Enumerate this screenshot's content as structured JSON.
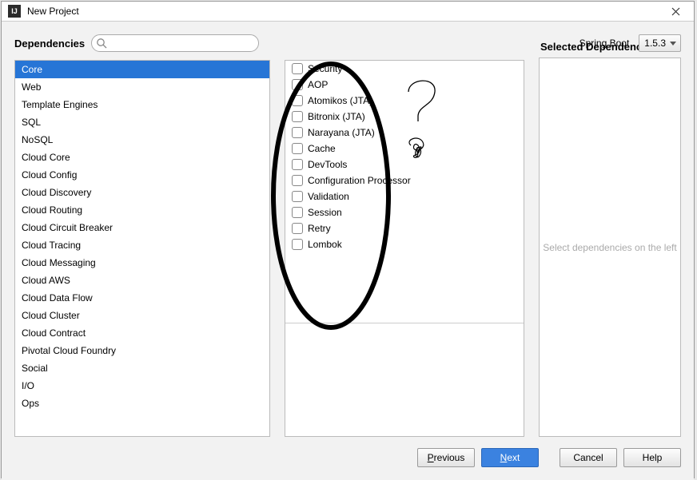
{
  "window": {
    "title": "New Project"
  },
  "header": {
    "dependencies_label": "Dependencies",
    "search_placeholder": "",
    "spring_boot_label": "Spring Boot",
    "spring_boot_version": "1.5.3"
  },
  "categories": [
    "Core",
    "Web",
    "Template Engines",
    "SQL",
    "NoSQL",
    "Cloud Core",
    "Cloud Config",
    "Cloud Discovery",
    "Cloud Routing",
    "Cloud Circuit Breaker",
    "Cloud Tracing",
    "Cloud Messaging",
    "Cloud AWS",
    "Cloud Data Flow",
    "Cloud Cluster",
    "Cloud Contract",
    "Pivotal Cloud Foundry",
    "Social",
    "I/O",
    "Ops"
  ],
  "selected_category_index": 0,
  "dependencies": [
    "Security",
    "AOP",
    "Atomikos (JTA)",
    "Bitronix (JTA)",
    "Narayana (JTA)",
    "Cache",
    "DevTools",
    "Configuration Processor",
    "Validation",
    "Session",
    "Retry",
    "Lombok"
  ],
  "right": {
    "title": "Selected Dependencies",
    "placeholder": "Select dependencies on the left"
  },
  "footer": {
    "previous": "Previous",
    "next": "Next",
    "cancel": "Cancel",
    "help": "Help"
  }
}
